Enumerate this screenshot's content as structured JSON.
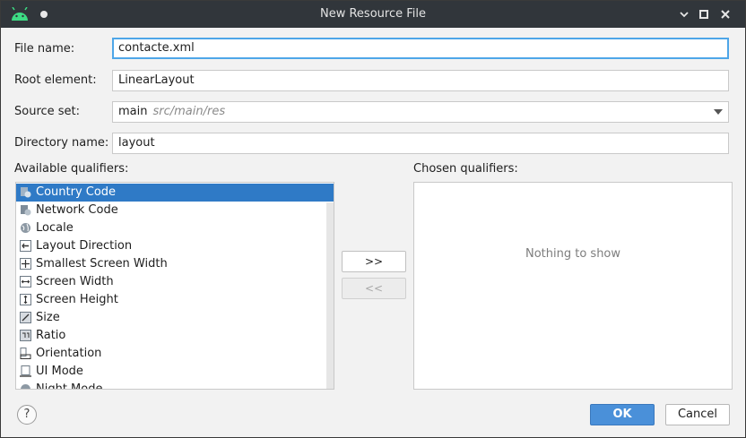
{
  "window": {
    "title": "New Resource File"
  },
  "form": {
    "file_name_label": "File name:",
    "file_name_value": "contacte.xml",
    "root_element_label": "Root element:",
    "root_element_value": "LinearLayout",
    "source_set_label": "Source set:",
    "source_set_value": "main",
    "source_set_path": "src/main/res",
    "directory_name_label": "Directory name:",
    "directory_name_value": "layout"
  },
  "qualifiers": {
    "available_label": "Available qualifiers:",
    "chosen_label": "Chosen qualifiers:",
    "items": [
      {
        "label": "Country Code",
        "icon": "country-code-icon",
        "selected": true
      },
      {
        "label": "Network Code",
        "icon": "network-code-icon",
        "selected": false
      },
      {
        "label": "Locale",
        "icon": "globe-icon",
        "selected": false
      },
      {
        "label": "Layout Direction",
        "icon": "layout-direction-icon",
        "selected": false
      },
      {
        "label": "Smallest Screen Width",
        "icon": "smallest-width-icon",
        "selected": false
      },
      {
        "label": "Screen Width",
        "icon": "screen-width-icon",
        "selected": false
      },
      {
        "label": "Screen Height",
        "icon": "screen-height-icon",
        "selected": false
      },
      {
        "label": "Size",
        "icon": "size-icon",
        "selected": false
      },
      {
        "label": "Ratio",
        "icon": "ratio-icon",
        "selected": false
      },
      {
        "label": "Orientation",
        "icon": "orientation-icon",
        "selected": false
      },
      {
        "label": "UI Mode",
        "icon": "ui-mode-icon",
        "selected": false
      },
      {
        "label": "Night Mode",
        "icon": "night-mode-icon",
        "selected": false
      }
    ],
    "add_button": ">>",
    "remove_button": "<<",
    "empty_text": "Nothing to show"
  },
  "buttons": {
    "ok": "OK",
    "cancel": "Cancel",
    "help": "?"
  },
  "colors": {
    "titlebar": "#31363b",
    "selection": "#2f7ac6",
    "primary": "#4a90d9",
    "focus": "#4ea6e8"
  }
}
